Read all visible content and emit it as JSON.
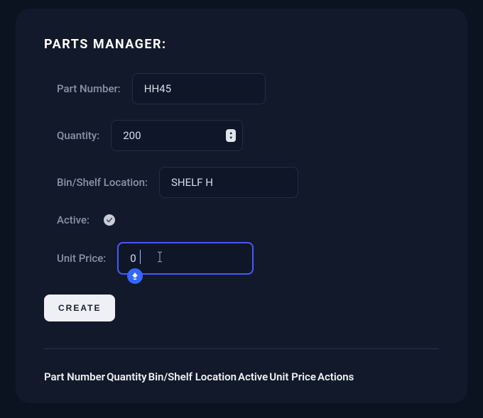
{
  "title": "PARTS MANAGER:",
  "form": {
    "partNumberLabel": "Part Number:",
    "partNumberValue": "HH45",
    "quantityLabel": "Quantity:",
    "quantityValue": "200",
    "locationLabel": "Bin/Shelf Location:",
    "locationValue": "SHELF H",
    "activeLabel": "Active:",
    "activeChecked": true,
    "unitPriceLabel": "Unit Price:",
    "unitPriceValue": "0",
    "createLabel": "CREATE"
  },
  "table": {
    "headers": [
      "Part Number",
      "Quantity",
      "Bin/Shelf Location",
      "Active",
      "Unit Price",
      "Actions"
    ]
  }
}
